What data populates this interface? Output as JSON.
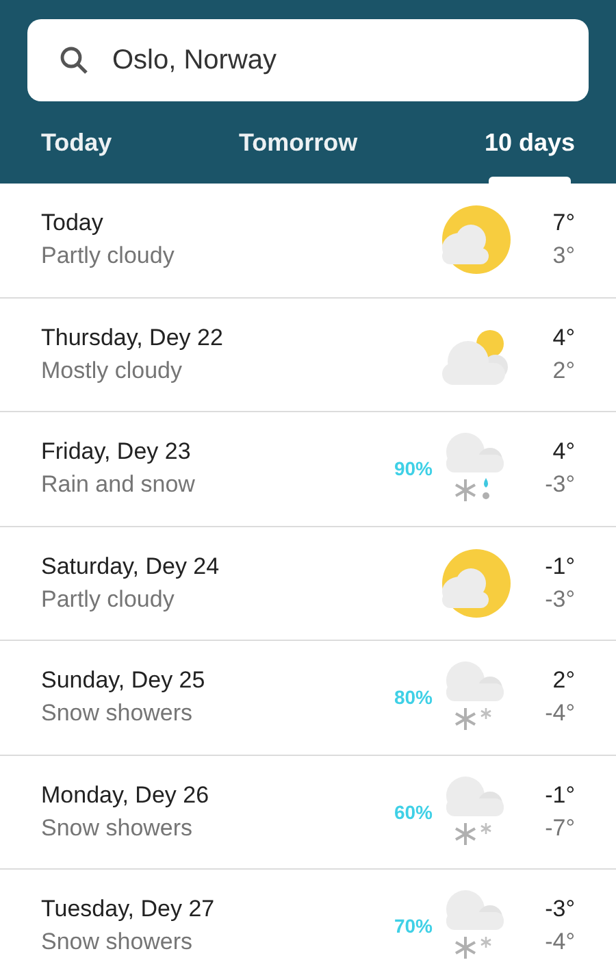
{
  "search": {
    "value": "Oslo, Norway"
  },
  "tabs": [
    {
      "label": "Today",
      "selected": false
    },
    {
      "label": "Tomorrow",
      "selected": false
    },
    {
      "label": "10 days",
      "selected": true
    }
  ],
  "days": [
    {
      "day": "Today",
      "condition": "Partly cloudy",
      "kind": "partly_cloudy",
      "high": "7°",
      "low": "3°"
    },
    {
      "day": "Thursday, Dey 22",
      "condition": "Mostly cloudy",
      "kind": "mostly_cloudy",
      "high": "4°",
      "low": "2°"
    },
    {
      "day": "Friday, Dey 23",
      "condition": "Rain and snow",
      "kind": "rain_snow",
      "precipitation": "90%",
      "high": "4°",
      "low": "-3°"
    },
    {
      "day": "Saturday, Dey 24",
      "condition": "Partly cloudy",
      "kind": "partly_cloudy",
      "high": "-1°",
      "low": "-3°"
    },
    {
      "day": "Sunday, Dey 25",
      "condition": "Snow showers",
      "kind": "snow_showers",
      "precipitation": "80%",
      "high": "2°",
      "low": "-4°"
    },
    {
      "day": "Monday, Dey 26",
      "condition": "Snow showers",
      "kind": "snow_showers",
      "precipitation": "60%",
      "high": "-1°",
      "low": "-7°"
    },
    {
      "day": "Tuesday, Dey 27",
      "condition": "Snow showers",
      "kind": "snow_showers",
      "precipitation": "70%",
      "high": "-3°",
      "low": "-4°"
    }
  ]
}
